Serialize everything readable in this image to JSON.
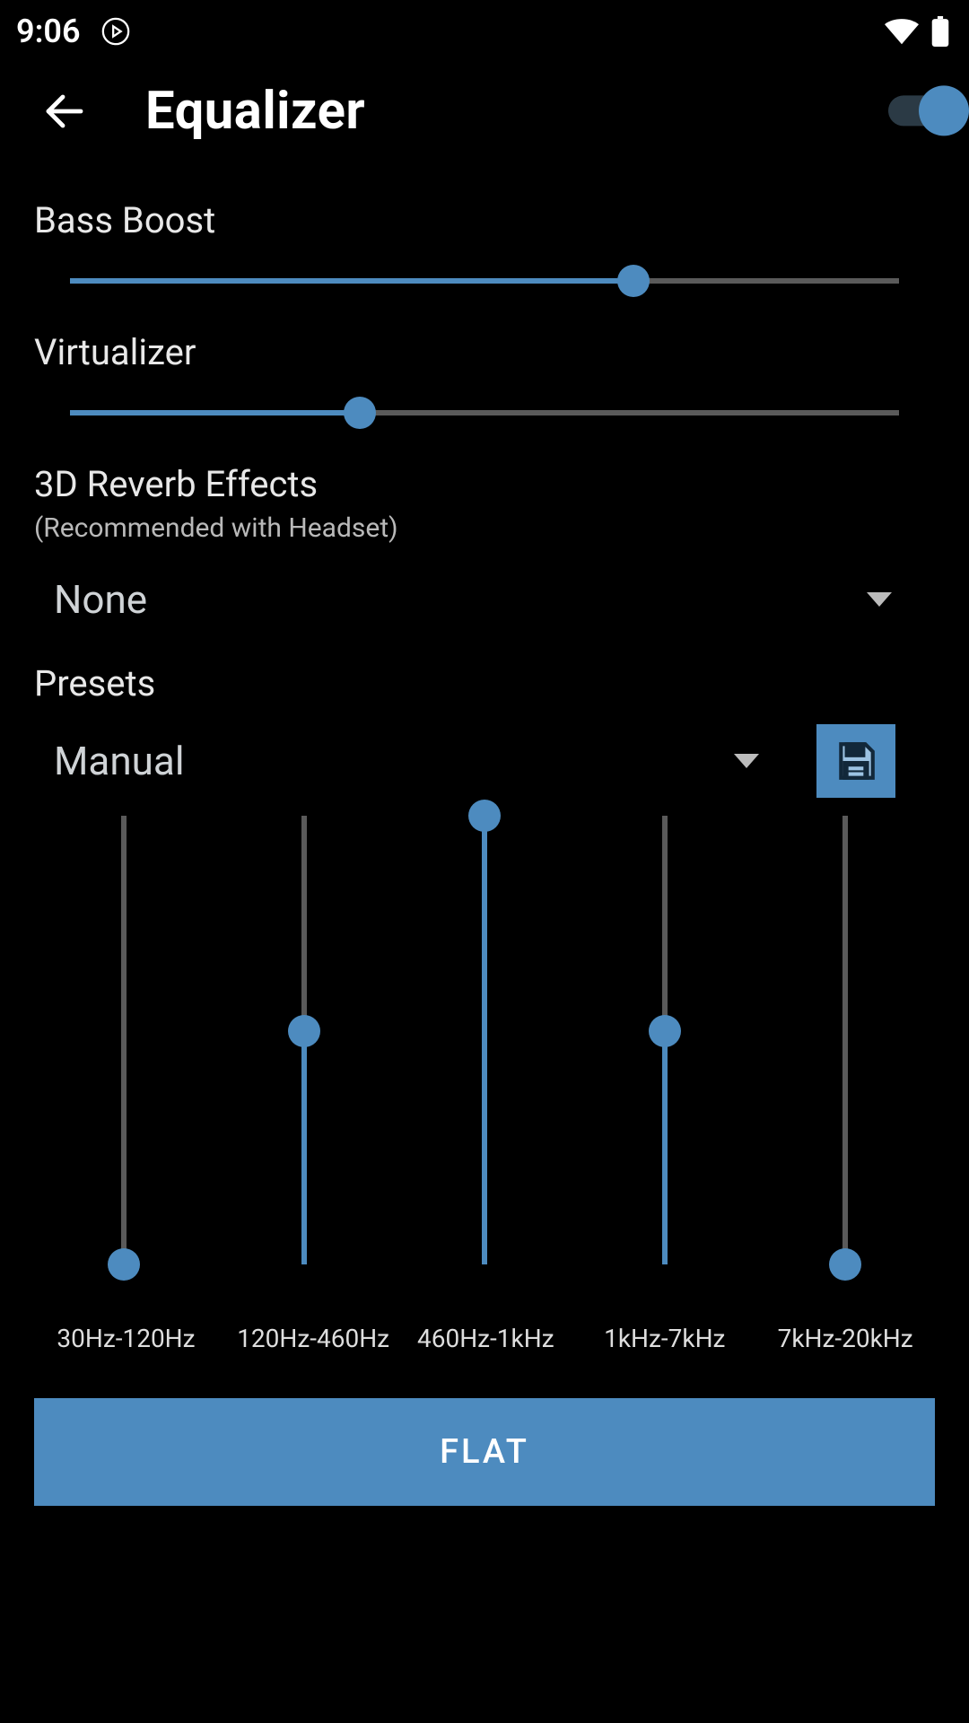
{
  "status": {
    "time": "9:06"
  },
  "header": {
    "title": "Equalizer",
    "enabled": true
  },
  "bass_boost": {
    "label": "Bass Boost",
    "value_pct": 68
  },
  "virtualizer": {
    "label": "Virtualizer",
    "value_pct": 35
  },
  "reverb": {
    "label": "3D Reverb Effects",
    "sub": "(Recommended with Headset)",
    "selected": "None"
  },
  "presets": {
    "label": "Presets",
    "selected": "Manual"
  },
  "eq": {
    "bands": [
      {
        "label": "30Hz-120Hz",
        "value_pct": 0
      },
      {
        "label": "120Hz-460Hz",
        "value_pct": 52
      },
      {
        "label": "460Hz-1kHz",
        "value_pct": 100
      },
      {
        "label": "1kHz-7kHz",
        "value_pct": 52
      },
      {
        "label": "7kHz-20kHz",
        "value_pct": 0
      }
    ]
  },
  "flat_button": {
    "label": "FLAT"
  },
  "colors": {
    "accent": "#4d8bbf",
    "track": "#5a5a5a"
  }
}
